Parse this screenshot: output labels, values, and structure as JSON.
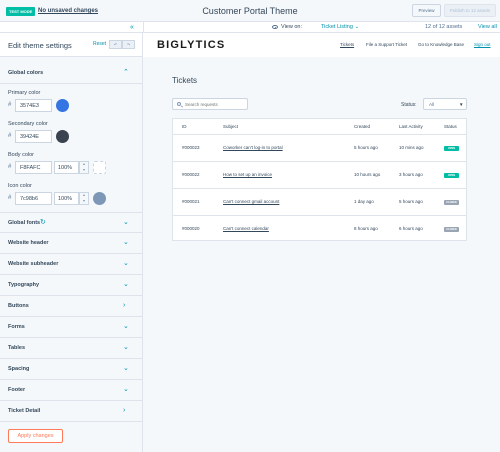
{
  "topbar": {
    "test_badge": "TEST MODE",
    "unsaved": "No unsaved changes",
    "title": "Customer Portal Theme",
    "preview_label": "Preview",
    "publish_label": "Publish to 12 assets"
  },
  "subbar": {
    "view_on_label": "View on:",
    "view_on_value": "Ticket Listing",
    "assets_count": "12 of 12 assets",
    "view_all": "View all"
  },
  "sidebar": {
    "title": "Edit theme settings",
    "reset": "Reset",
    "global_colors": {
      "label": "Global colors",
      "primary": {
        "label": "Primary color",
        "hex": "3574E3",
        "swatch": "#3574e3"
      },
      "secondary": {
        "label": "Secondary color",
        "hex": "39424E",
        "swatch": "#39424e"
      },
      "body": {
        "label": "Body color",
        "hex": "F8FAFC",
        "opacity": "100%",
        "swatch": "#f8fafc"
      },
      "icon": {
        "label": "Icon color",
        "hex": "7c98b6",
        "opacity": "100%",
        "swatch": "#7c98b6"
      }
    },
    "sections": [
      {
        "label": "Global fonts"
      },
      {
        "label": "Website header"
      },
      {
        "label": "Website subheader"
      },
      {
        "label": "Typography"
      },
      {
        "label": "Buttons"
      },
      {
        "label": "Forms"
      },
      {
        "label": "Tables"
      },
      {
        "label": "Spacing"
      },
      {
        "label": "Footer"
      },
      {
        "label": "Ticket Detail"
      }
    ],
    "apply": "Apply changes"
  },
  "site": {
    "logo": "BIGLYTICS",
    "nav": [
      "Tickets",
      "File a Support Ticket",
      "Go to Knowledge Base",
      "Sign out"
    ],
    "page_title": "Tickets",
    "search_placeholder": "Search requests",
    "status_label": "Status:",
    "status_value": "All",
    "table": {
      "headers": [
        "ID",
        "Subject",
        "Created",
        "Last Activity",
        "Status"
      ],
      "rows": [
        {
          "id": "#000023",
          "subject": "Coworker can't log-in to portal",
          "created": "5 hours ago",
          "activity": "10 mins ago",
          "status": "OPEN"
        },
        {
          "id": "#000022",
          "subject": "How to set up an invoice",
          "created": "10 hours ago",
          "activity": "3 hours ago",
          "status": "OPEN"
        },
        {
          "id": "#000021",
          "subject": "Can't connect gmail account",
          "created": "1 day ago",
          "activity": "5 hours ago",
          "status": "CLOSED"
        },
        {
          "id": "#000020",
          "subject": "Can't connect calendar",
          "created": "8 hours ago",
          "activity": "6 hours ago",
          "status": "CLOSED"
        }
      ]
    },
    "colors": {
      "open": "#00bda5",
      "closed": "#99a5b3",
      "accent": "#0091ae",
      "cta": "#ff7a59"
    }
  }
}
